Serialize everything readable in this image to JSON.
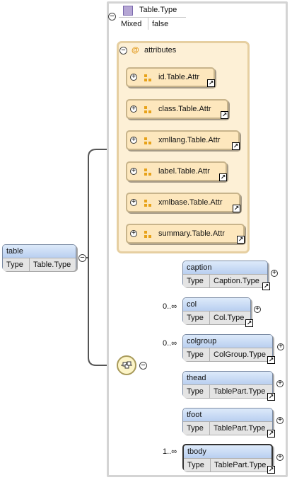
{
  "root_element": {
    "name": "table",
    "type_key": "Type",
    "type_value": "Table.Type"
  },
  "complex_type": {
    "name": "Table.Type",
    "mixed_key": "Mixed",
    "mixed_value": "false"
  },
  "attributes_group": {
    "label": "attributes",
    "icon": "at-sign-icon",
    "items": [
      {
        "label": "id.Table.Attr"
      },
      {
        "label": "class.Table.Attr"
      },
      {
        "label": "xmllang.Table.Attr"
      },
      {
        "label": "label.Table.Attr"
      },
      {
        "label": "xmlbase.Table.Attr"
      },
      {
        "label": "summary.Table.Attr"
      }
    ]
  },
  "sequence": {
    "icon": "sequence-compositor-icon",
    "children": [
      {
        "name": "caption",
        "type_key": "Type",
        "type_value": "Caption.Type",
        "cardinality": ""
      },
      {
        "name": "col",
        "type_key": "Type",
        "type_value": "Col.Type",
        "cardinality": "0..∞"
      },
      {
        "name": "colgroup",
        "type_key": "Type",
        "type_value": "ColGroup.Type",
        "cardinality": "0..∞"
      },
      {
        "name": "thead",
        "type_key": "Type",
        "type_value": "TablePart.Type",
        "cardinality": ""
      },
      {
        "name": "tfoot",
        "type_key": "Type",
        "type_value": "TablePart.Type",
        "cardinality": ""
      },
      {
        "name": "tbody",
        "type_key": "Type",
        "type_value": "TablePart.Type",
        "cardinality": "1..∞"
      }
    ]
  },
  "colors": {
    "element_header": "#c9dbf5",
    "attr_fill": "#fde7bd",
    "attr_group_fill": "#fdf0d6",
    "type_swatch": "#b5a6d4"
  }
}
